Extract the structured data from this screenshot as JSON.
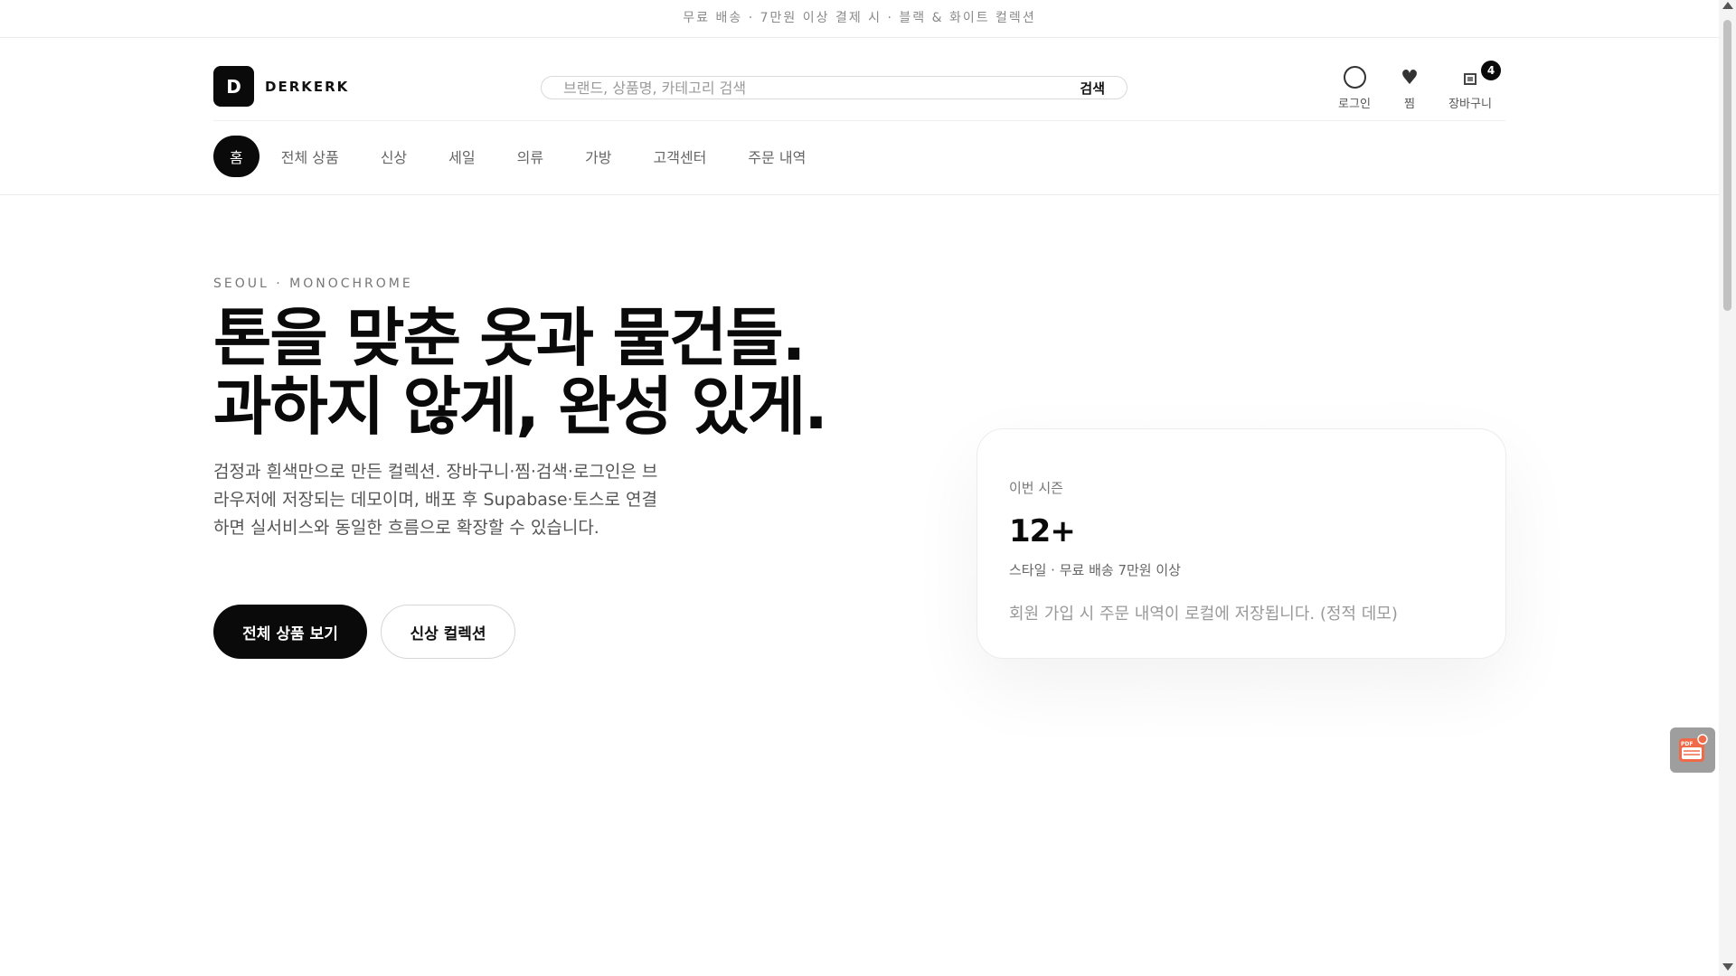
{
  "announcement": "무료 배송 · 7만원 이상 결제 시 · 블랙 & 화이트 컬렉션",
  "brand": {
    "mark": "D",
    "name": "DERKERK"
  },
  "search": {
    "placeholder": "브랜드, 상품명, 카테고리 검색",
    "button": "검색"
  },
  "utility": {
    "login": "로그인",
    "wishlist": "찜",
    "cart": "장바구니",
    "cart_count": "4"
  },
  "nav": {
    "items": [
      "홈",
      "전체 상품",
      "신상",
      "세일",
      "의류",
      "가방",
      "고객센터",
      "주문 내역"
    ],
    "active": "홈"
  },
  "hero": {
    "eyebrow": "SEOUL · MONOCHROME",
    "headline_line1": "톤을 맞춘 옷과 물건들.",
    "headline_line2": "과하지 않게, 완성 있게.",
    "description": "검정과 흰색만으로 만든 컬렉션. 장바구니·찜·검색·로그인은 브라우저에 저장되는 데모이며, 배포 후 Supabase·토스로 연결하면 실서비스와 동일한 흐름으로 확장할 수 있습니다.",
    "primary_button": "전체 상품 보기",
    "secondary_button": "신상 컬렉션"
  },
  "season_card": {
    "label": "이번 시즌",
    "stat": "12+",
    "sub": "스타일 · 무료 배송 7만원 이상",
    "note": "회원 가입 시 주문 내역이 로컬에 저장됩니다. (정적 데모)"
  },
  "colors": {
    "primary": "#0a0a0a",
    "background": "#ffffff",
    "muted": "#777777",
    "border": "#ececec"
  }
}
